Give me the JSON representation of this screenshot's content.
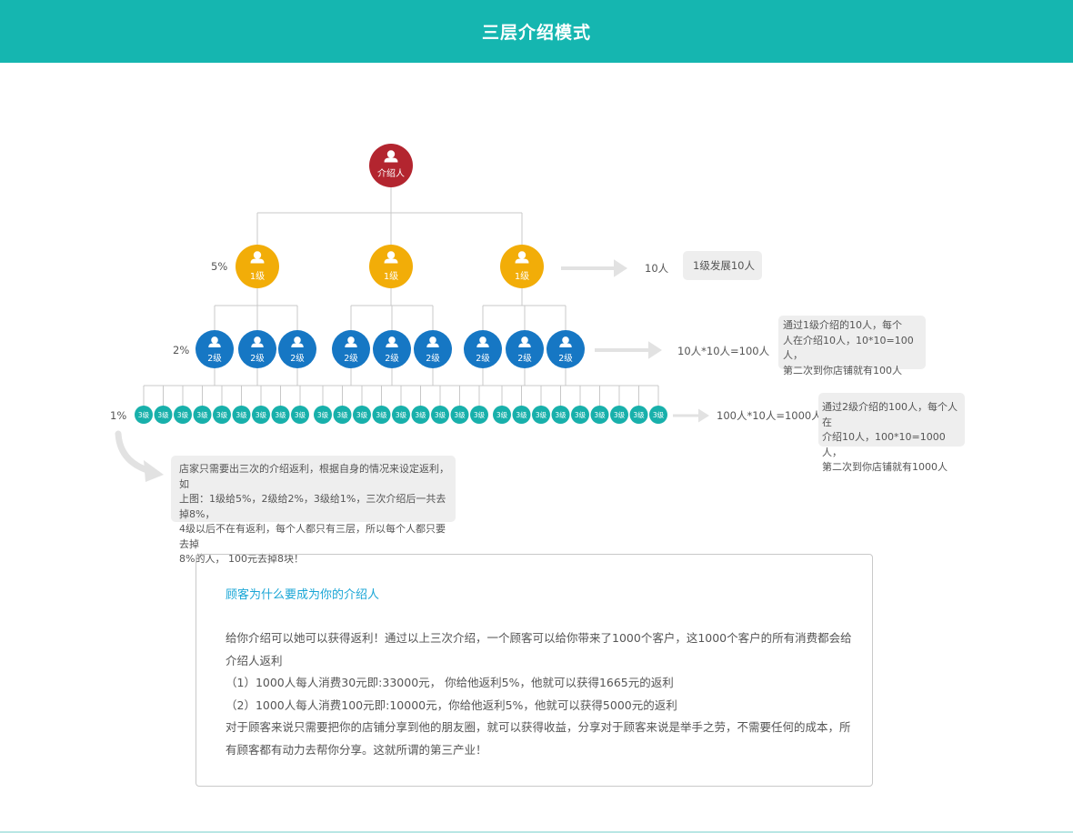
{
  "header": {
    "title": "三层介绍模式"
  },
  "colors": {
    "header": "#15b6b0",
    "root": "#b3252f",
    "level1": "#f2ad08",
    "level2": "#1677c4",
    "level3": "#18b0ab",
    "title_text": "#1aa6d6"
  },
  "tree": {
    "root": {
      "label": "介绍人",
      "icon": "user-icon"
    },
    "level1": {
      "label": "1级",
      "count": 3,
      "rate": "5%",
      "result": "10人"
    },
    "level2": {
      "label": "2级",
      "per_parent": 3,
      "rate": "2%",
      "result": "10人*10人=100人"
    },
    "level3": {
      "label": "3级",
      "count": 27,
      "rate": "1%",
      "result": "100人*10人=1000人"
    }
  },
  "bubbles": {
    "level1_note": "1级发展10人",
    "level2_note": "通过1级介绍的10人，每个\n人在介绍10人，10*10=100人，\n第二次到你店铺就有100人",
    "level3_note": "通过2级介绍的100人，每个人在\n介绍10人，100*10=1000人，\n第二次到你店铺就有1000人",
    "rule_note": "店家只需要出三次的介绍返利，根据自身的情况来设定返利，如\n上图：1级给5%，2级给2%，3级给1%，三次介绍后一共去掉8%，\n4级以后不在有返利，每个人都只有三层，所以每个人都只要去掉\n8%的人， 100元去掉8块！"
  },
  "info": {
    "title": "顾客为什么要成为你的介绍人",
    "paragraphs": [
      "给你介绍可以她可以获得返利！通过以上三次介绍，一个顾客可以给你带来了1000个客户，这1000个客户的所有消费都会给介绍人返利",
      "（1）1000人每人消费30元即:33000元， 你给他返利5%，他就可以获得1665元的返利",
      "（2）1000人每人消费100元即:10000元，你给他返利5%，他就可以获得5000元的返利",
      "对于顾客来说只需要把你的店铺分享到他的朋友圈，就可以获得收益，分享对于顾客来说是举手之劳，不需要任何的成本，所有顾客都有动力去帮你分享。这就所谓的第三产业！"
    ]
  }
}
